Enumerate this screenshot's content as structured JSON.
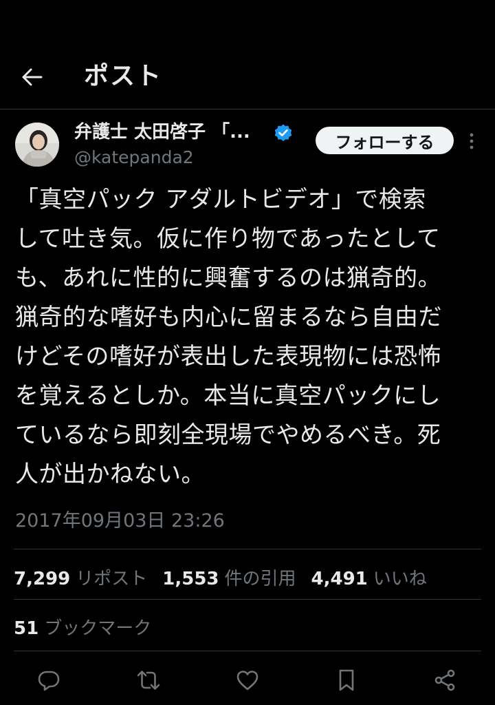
{
  "header": {
    "title": "ポスト",
    "back_icon": "arrow-left-icon"
  },
  "author": {
    "display_name": "弁護士 太田啓子 「...",
    "handle": "@katepanda2",
    "verified_icon": "verified-badge-icon",
    "verified_color": "#1d9bf0",
    "follow_label": "フォローする",
    "more_icon": "more-vertical-icon"
  },
  "tweet": {
    "lines": [
      "「真空パック アダルトビデオ」で検索",
      "して吐き気。仮に作り物であったとして",
      "も、あれに性的に興奮するのは猟奇的。",
      "猟奇的な嗜好も内心に留まるなら自由だ",
      "けどその嗜好が表出した表現物には恐怖",
      "を覚えるとしか。本当に真空パックにし",
      "ているなら即刻全現場でやめるべき。死",
      "人が出かねない。"
    ],
    "timestamp": "2017年09月03日 23:26"
  },
  "stats": {
    "reposts": {
      "count": "7,299",
      "label": "リポスト"
    },
    "quotes": {
      "count": "1,553",
      "label": "件の引用"
    },
    "likes": {
      "count": "4,491",
      "label": "いいね"
    },
    "bookmarks": {
      "count": "51",
      "label": "ブックマーク"
    }
  },
  "actions": {
    "reply_icon": "reply-icon",
    "repost_icon": "repost-icon",
    "like_icon": "heart-icon",
    "bookmark_icon": "bookmark-icon",
    "share_icon": "share-icon"
  },
  "colors": {
    "background": "#000000",
    "text": "#e7e9ea",
    "secondary": "#71767b",
    "border": "#2f3336",
    "follow_bg": "#eff3f4"
  }
}
